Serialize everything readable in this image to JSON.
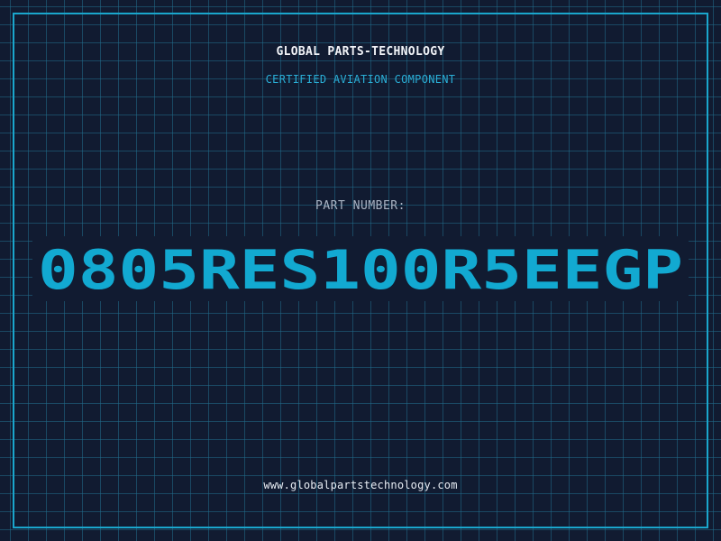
{
  "company": "GLOBAL PARTS-TECHNOLOGY",
  "tagline": "CERTIFIED AVIATION COMPONENT",
  "part_label": "PART NUMBER:",
  "part_number": "0805RES100R5EEGP",
  "website": "www.globalpartstechnology.com",
  "colors": {
    "background": "#111b31",
    "grid": "#1f6e8c",
    "frame": "#1aa6cc",
    "accent": "#12a9d1",
    "title_text": "#f2f4f8",
    "label_text": "#a9b3c3"
  }
}
